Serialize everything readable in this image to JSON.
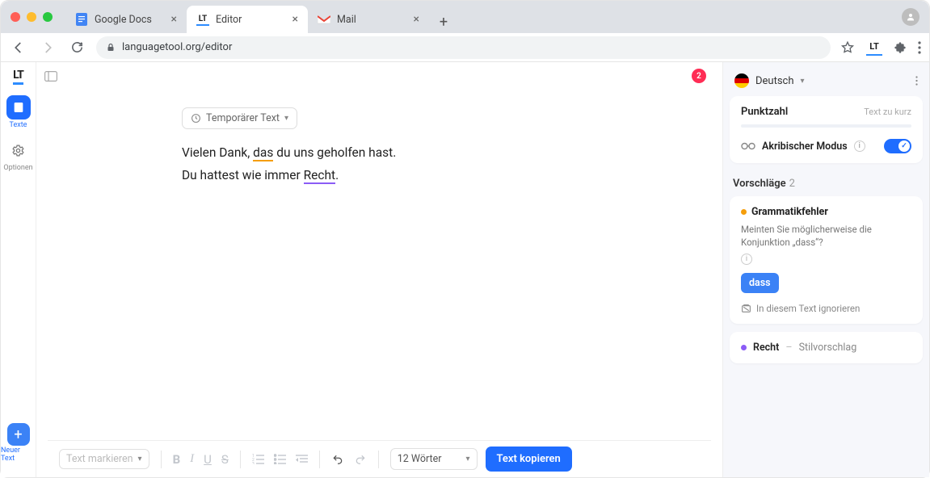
{
  "browser": {
    "tabs": [
      {
        "title": "Google Docs"
      },
      {
        "title": "Editor"
      },
      {
        "title": "Mail"
      }
    ],
    "url": "languagetool.org/editor"
  },
  "leftRail": {
    "texte": "Texte",
    "optionen": "Optionen",
    "neuerText": "Neuer Text"
  },
  "editor": {
    "errorCount": "2",
    "tempChip": "Temporärer Text",
    "line1_a": "Vielen Dank, ",
    "line1_hl": "das",
    "line1_b": " du uns geholfen hast.",
    "line2_a": "Du hattest wie immer ",
    "line2_hl": "Recht",
    "line2_b": ".",
    "markText": "Text markieren",
    "wordCount": "12 Wörter",
    "copyBtn": "Text kopieren"
  },
  "rightPanel": {
    "language": "Deutsch",
    "scoreLabel": "Punktzahl",
    "scoreHint": "Text zu kurz",
    "modeLabel": "Akribischer Modus",
    "suggestionsTitle": "Vorschläge",
    "suggestionsCount": "2",
    "sugg1": {
      "type": "Grammatikfehler",
      "desc": "Meinten Sie möglicherweise die Konjunktion „dass“?",
      "replacement": "dass",
      "ignore": "In diesem Text ignorieren"
    },
    "sugg2": {
      "word": "Recht",
      "type": "Stilvorschlag"
    }
  }
}
